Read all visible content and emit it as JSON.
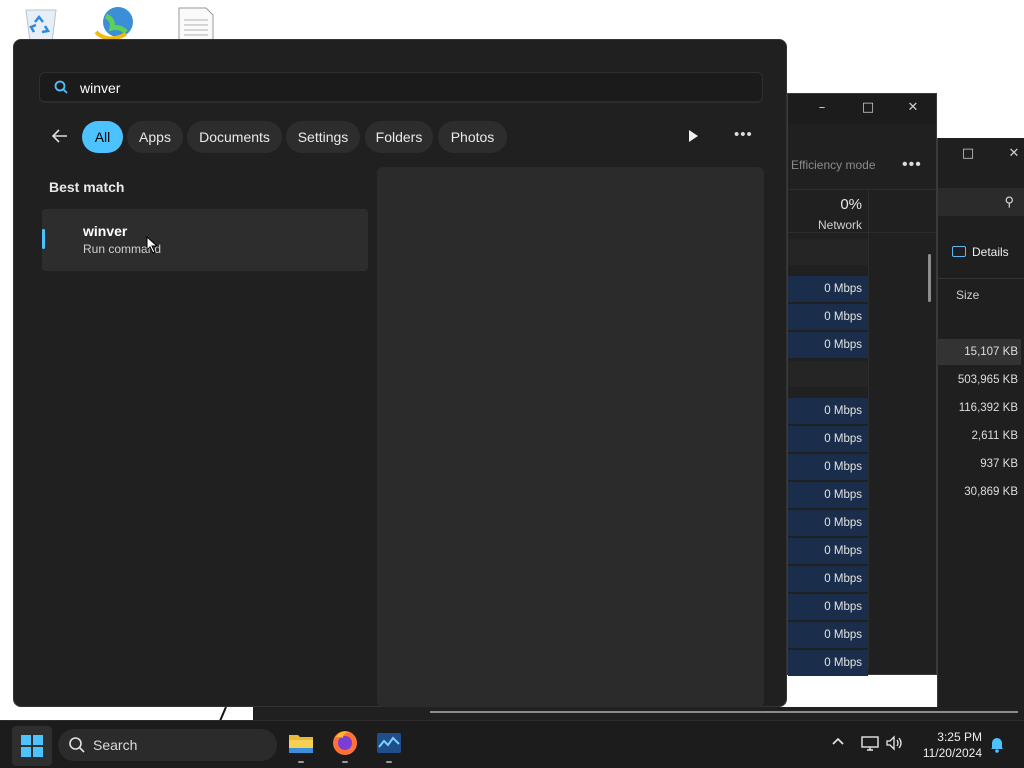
{
  "search": {
    "query": "winver"
  },
  "filters": [
    {
      "label": "All",
      "active": true
    },
    {
      "label": "Apps"
    },
    {
      "label": "Documents"
    },
    {
      "label": "Settings"
    },
    {
      "label": "Folders"
    },
    {
      "label": "Photos"
    }
  ],
  "best_match": {
    "title": "Best match",
    "result": {
      "name": "winver",
      "subtitle": "Run command"
    }
  },
  "task_manager": {
    "efficiency_mode": "Efficiency mode",
    "network_percent": "0%",
    "network_label": "Network",
    "network_rows": [
      "0 Mbps",
      "0 Mbps",
      "0 Mbps",
      "0 Mbps",
      "0 Mbps",
      "0 Mbps",
      "0 Mbps",
      "0 Mbps",
      "0 Mbps",
      "0 Mbps",
      "0 Mbps",
      "0 Mbps",
      "0 Mbps"
    ],
    "details_label": "Details",
    "size_header": "Size",
    "sizes": [
      "15,107 KB",
      "503,965 KB",
      "116,392 KB",
      "2,611 KB",
      "937 KB",
      "30,869 KB"
    ]
  },
  "taskbar": {
    "search_label": "Search",
    "time": "3:25 PM",
    "date": "11/20/2024"
  },
  "colors": {
    "accent": "#4cc2ff",
    "panel_bg": "#202020",
    "network_row": "#1a2d4b"
  },
  "icons": [
    "search-icon",
    "back-arrow-icon",
    "play-icon",
    "more-icon",
    "windows-start-icon",
    "file-explorer-icon",
    "firefox-icon",
    "task-manager-icon",
    "chevron-up-icon",
    "network-icon",
    "volume-icon",
    "notification-bell-icon"
  ]
}
